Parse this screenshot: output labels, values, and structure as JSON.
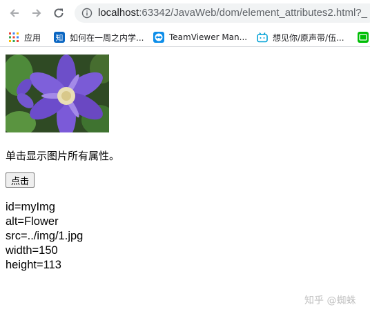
{
  "browser": {
    "url_host": "localhost",
    "url_path": ":63342/JavaWeb/dom/element_attributes2.html?_",
    "bookmarks": [
      {
        "label": "应用",
        "icon": "apps-grid-icon"
      },
      {
        "label": "如何在一周之内学...",
        "icon": "zhihu-icon"
      },
      {
        "label": "TeamViewer Man...",
        "icon": "teamviewer-icon"
      },
      {
        "label": "想见你/原声带/伍...",
        "icon": "bilibili-icon"
      },
      {
        "label": "",
        "icon": "iqiyi-icon"
      }
    ]
  },
  "page": {
    "image_alt": "Flower",
    "caption": "单击显示图片所有属性。",
    "button_label": "点击",
    "attributes": [
      "id=myImg",
      "alt=Flower",
      "src=../img/1.jpg",
      "width=150",
      "height=113"
    ]
  },
  "watermark": "知乎 @蜘蛛"
}
